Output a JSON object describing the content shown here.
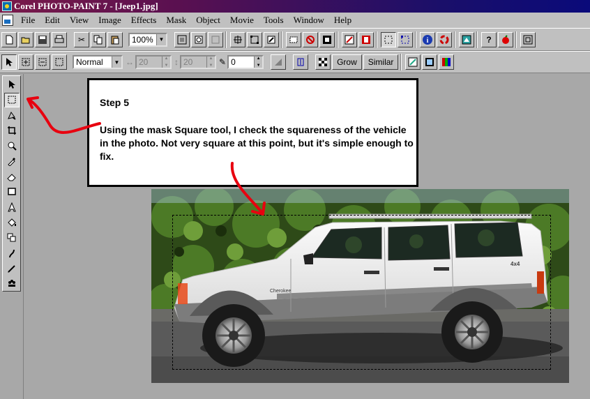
{
  "window": {
    "title": "Corel PHOTO-PAINT 7 - [Jeep1.jpg]"
  },
  "menu": [
    "File",
    "Edit",
    "View",
    "Image",
    "Effects",
    "Mask",
    "Object",
    "Movie",
    "Tools",
    "Window",
    "Help"
  ],
  "toolbar": {
    "zoom_value": "100%",
    "icons": [
      "new-icon",
      "open-icon",
      "save-icon",
      "print-icon",
      "cut-icon",
      "copy-icon",
      "paste-icon",
      "zoom-icon",
      "help-icon"
    ]
  },
  "property_bar": {
    "mode_value": "Normal",
    "width_value": "20",
    "height_value": "20",
    "feather_value": "0",
    "grow_label": "Grow",
    "similar_label": "Similar"
  },
  "callout": {
    "heading": "Step 5",
    "body": "Using the mask Square tool, I check the squareness of the vehicle in the photo. Not very square at this point, but  it's simple enough to fix."
  },
  "colors": {
    "title_start": "#7a1a4a",
    "title_end": "#0a0a7a",
    "arrow": "#e8000f",
    "jeep_body": "#f4f4f4"
  },
  "photo": {
    "jeep_badge": "4x4"
  }
}
